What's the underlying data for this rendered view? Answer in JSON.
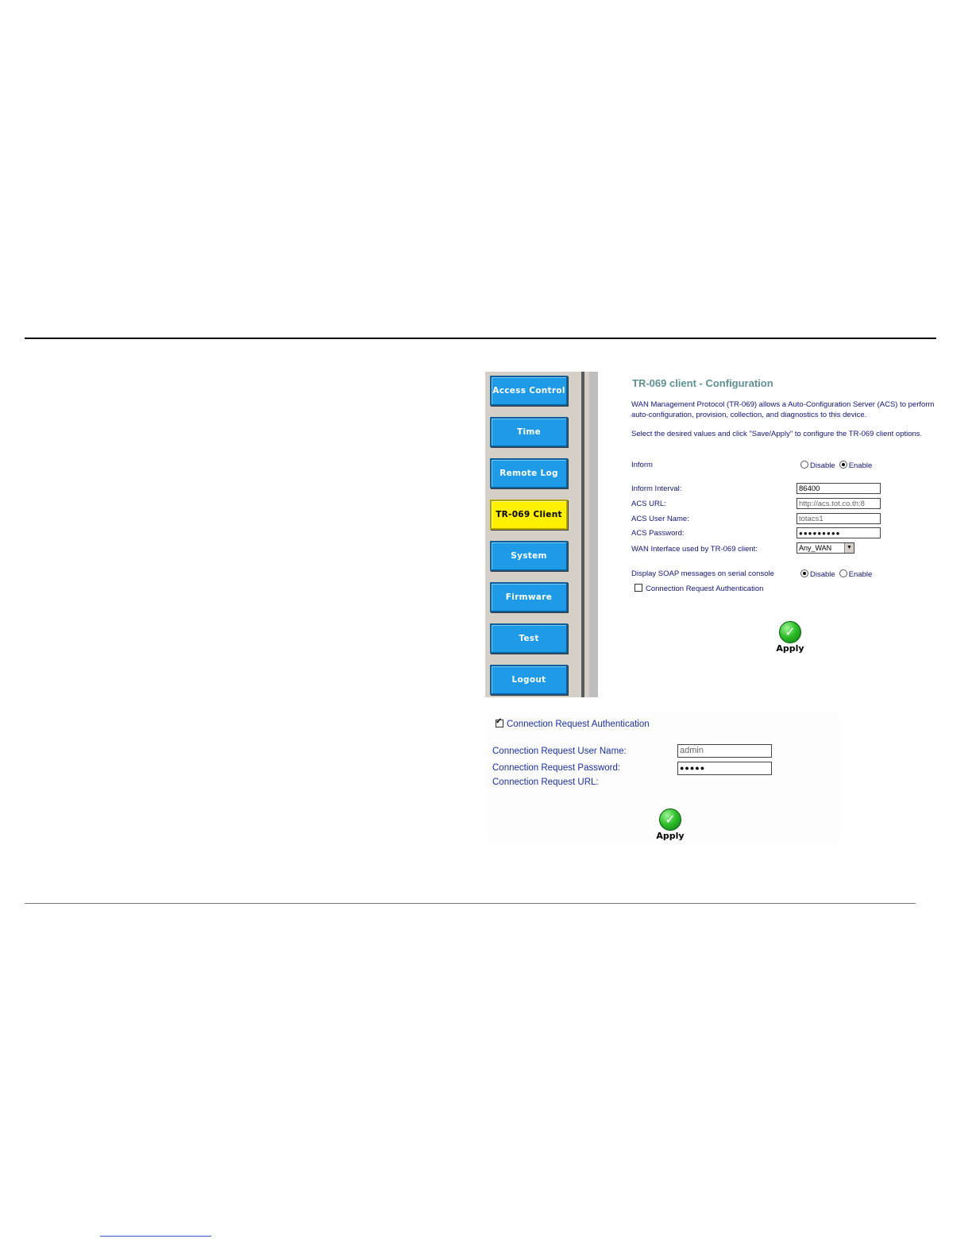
{
  "nav": {
    "items": [
      {
        "label": "Access Control",
        "active": false
      },
      {
        "label": "Time",
        "active": false
      },
      {
        "label": "Remote Log",
        "active": false
      },
      {
        "label": "TR-069 Client",
        "active": true
      },
      {
        "label": "System",
        "active": false
      },
      {
        "label": "Firmware",
        "active": false
      },
      {
        "label": "Test",
        "active": false
      },
      {
        "label": "Logout",
        "active": false
      }
    ]
  },
  "config": {
    "title": "TR-069 client - Configuration",
    "intro": "WAN Management Protocol (TR-069) allows a Auto-Configuration Server (ACS) to perform auto-configuration, provision, collection, and diagnostics to this device.",
    "instructions": "Select the desired values and click \"Save/Apply\" to configure the TR-069 client options.",
    "inform_label": "Inform",
    "disable_label": "Disable",
    "enable_label": "Enable",
    "inform_value": "Enable",
    "inform_interval_label": "Inform Interval:",
    "inform_interval_value": "86400",
    "acs_url_label": "ACS URL:",
    "acs_url_value": "http://acs.tot.co.th:8",
    "acs_user_label": "ACS User Name:",
    "acs_user_value": "totacs1",
    "acs_password_label": "ACS Password:",
    "acs_password_value": "●●●●●●●●●",
    "wan_interface_label": "WAN Interface used by TR-069 client:",
    "wan_interface_value": "Any_WAN",
    "soap_label": "Display SOAP messages on serial console",
    "soap_value": "Disable",
    "conn_auth_label": "Connection Request Authentication",
    "conn_auth_checked": false,
    "apply_label": "Apply"
  },
  "auth": {
    "conn_auth_label": "Connection Request Authentication",
    "conn_auth_checked": true,
    "user_label": "Connection Request User Name:",
    "user_value": "admin",
    "password_label": "Connection Request Password:",
    "password_value": "●●●●●",
    "url_label": "Connection Request URL:",
    "apply_label": "Apply"
  }
}
